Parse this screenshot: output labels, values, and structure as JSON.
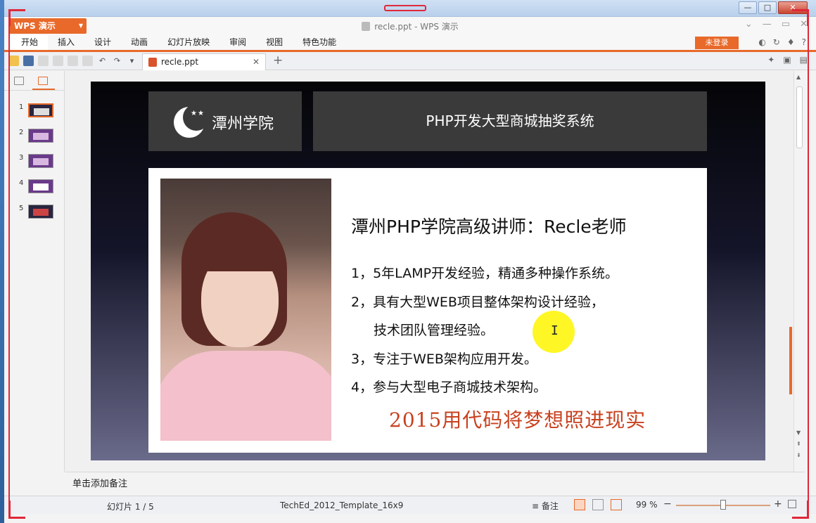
{
  "app": {
    "logo_label": "WPS 演示",
    "window_title": "recle.ppt - WPS 演示",
    "login_label": "未登录"
  },
  "ribbon": {
    "tabs": [
      "开始",
      "插入",
      "设计",
      "动画",
      "幻灯片放映",
      "审阅",
      "视图",
      "特色功能"
    ]
  },
  "doc_tab": {
    "label": "recle.ppt"
  },
  "slides": {
    "numbers": [
      "1",
      "2",
      "3",
      "4",
      "5"
    ]
  },
  "slide": {
    "logo_text": "潭州学院",
    "header_title": "PHP开发大型商城抽奖系统",
    "speaker": "潭州PHP学院高级讲师：Recle老师",
    "bullets": [
      "1，5年LAMP开发经验，精通多种操作系统。",
      "2，具有大型WEB项目整体架构设计经验，",
      "技术团队管理经验。",
      "3，专注于WEB架构应用开发。",
      "4，参与大型电子商城技术架构。"
    ],
    "slogan": "2015用代码将梦想照进现实"
  },
  "notes": {
    "placeholder": "单击添加备注"
  },
  "status": {
    "slide_counter": "幻灯片 1 / 5",
    "template": "TechEd_2012_Template_16x9",
    "notes_label": "备注",
    "zoom": "99 %"
  },
  "colors": {
    "accent": "#e8692a",
    "slogan": "#c8411f"
  }
}
